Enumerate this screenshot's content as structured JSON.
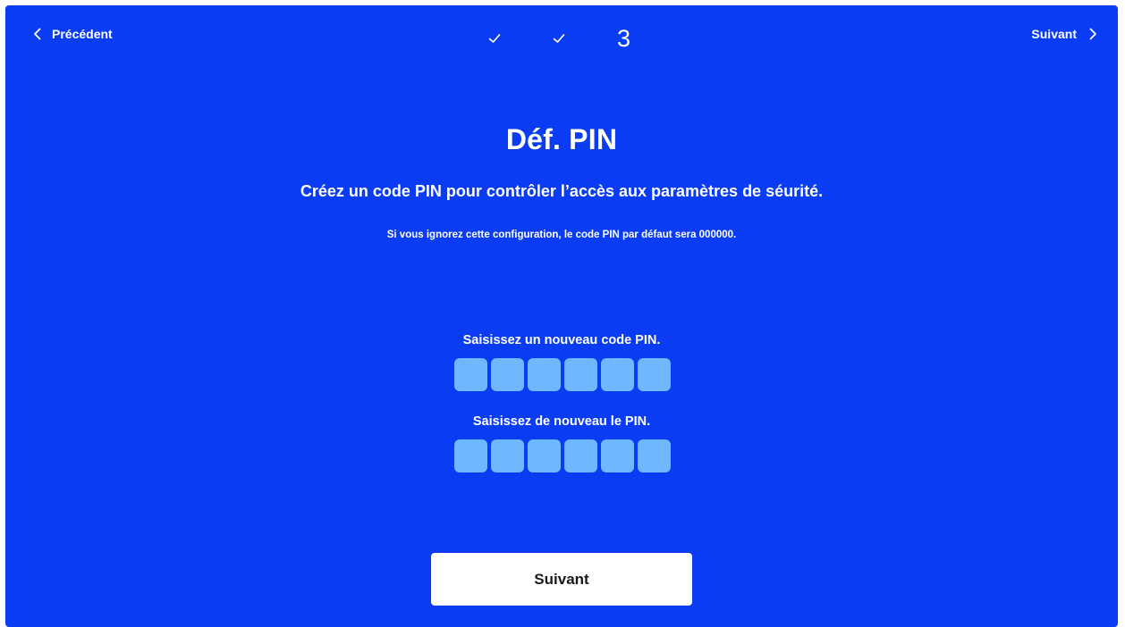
{
  "colors": {
    "background": "#0a3cf4",
    "pin_box": "#6db8ff",
    "button_bg": "#ffffff",
    "button_text": "#1a1a1a"
  },
  "nav": {
    "prev_label": "Précédent",
    "prev_icon": "chevron-left-icon",
    "next_label": "Suivant",
    "next_icon": "chevron-right-icon"
  },
  "steps": {
    "completed_icon": "checkmark-icon",
    "current_number": "3"
  },
  "heading": {
    "title": "Déf. PIN",
    "subtitle": "Créez un code PIN pour contrôler l’accès aux paramètres de séurité.",
    "note": "Si vous ignorez cette configuration, le code PIN par défaut sera 000000."
  },
  "pin_entry": {
    "new_pin_label": "Saisissez un nouveau code PIN.",
    "confirm_pin_label": "Saisissez de nouveau le PIN.",
    "digits": 6
  },
  "footer": {
    "next_button_label": "Suivant"
  }
}
